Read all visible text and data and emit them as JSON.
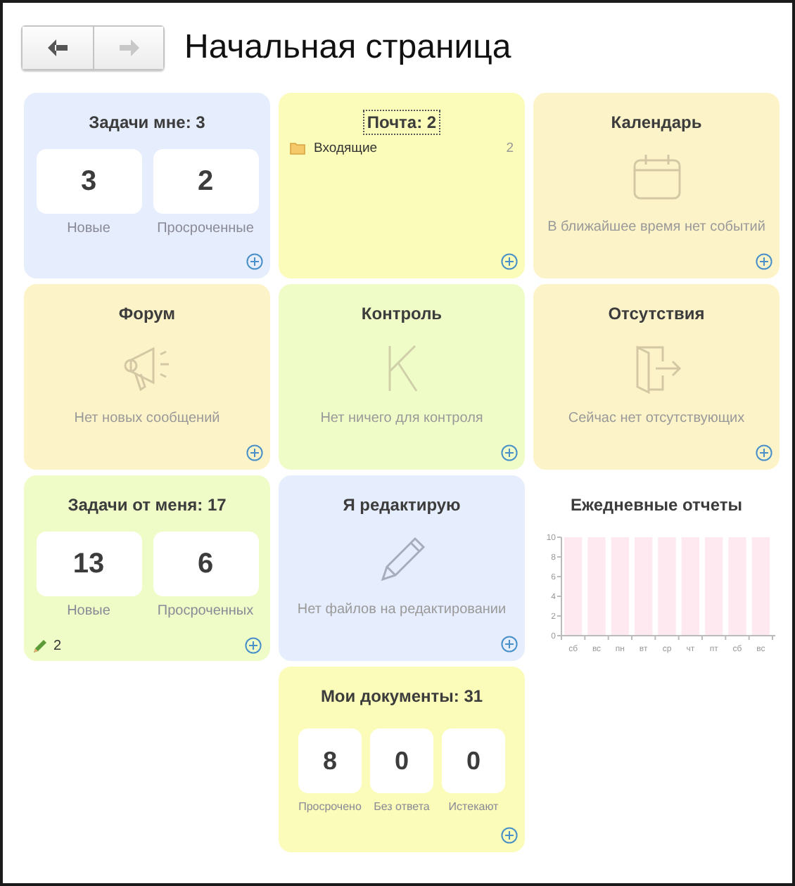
{
  "nav": {
    "back": {
      "disabled": false
    },
    "forward": {
      "disabled": true
    }
  },
  "title": "Начальная страница",
  "tiles": [
    {
      "kind": "counters",
      "title": "Задачи мне: 3",
      "color": "#e6edfc",
      "focused": false,
      "counters": [
        {
          "value": "3",
          "label": "Новые"
        },
        {
          "value": "2",
          "label": "Просроченные"
        }
      ]
    },
    {
      "kind": "mail",
      "title": "Почта: 2",
      "color": "#fbfcb9",
      "focused": true,
      "folders": [
        {
          "name": "Входящие",
          "count": "2"
        }
      ]
    },
    {
      "kind": "empty",
      "title": "Календарь",
      "color": "#fdf3c9",
      "focused": false,
      "message": "В ближайшее время нет событий"
    },
    {
      "kind": "empty",
      "title": "Форум",
      "color": "#fdf3c9",
      "focused": false,
      "message": "Нет новых сообщений"
    },
    {
      "kind": "empty",
      "title": "Контроль",
      "color": "#f0fcc8",
      "focused": false,
      "message": "Нет ничего для контроля"
    },
    {
      "kind": "empty",
      "title": "Отсутствия",
      "color": "#fdf3c9",
      "focused": false,
      "message": "Сейчас нет отсутствующих"
    },
    {
      "kind": "counters",
      "title": "Задачи от меня: 17",
      "color": "#f0fcc8",
      "focused": false,
      "counters": [
        {
          "value": "13",
          "label": "Новые"
        },
        {
          "value": "6",
          "label": "Просроченных"
        }
      ],
      "edits": "2"
    },
    {
      "kind": "empty",
      "title": "Я редактирую",
      "color": "#e6edfc",
      "focused": false,
      "message": "Нет файлов на редактировании"
    },
    {
      "kind": "chart",
      "title": "Ежедневные отчеты",
      "focused": false,
      "chart_data": {
        "type": "bar",
        "categories": [
          "сб",
          "вс",
          "пн",
          "вт",
          "ср",
          "чт",
          "пт",
          "сб",
          "вс"
        ],
        "series": [
          {
            "color": "#fde9ef",
            "values": [
              10,
              10,
              10,
              10,
              10,
              10,
              10,
              10,
              10
            ]
          }
        ],
        "ylim": [
          0,
          10
        ],
        "yticks": [
          0,
          2,
          4,
          6,
          8,
          10
        ]
      }
    },
    {
      "kind": "counters",
      "title": "Мои документы: 31",
      "color": "#fbfcb9",
      "focused": false,
      "counters": [
        {
          "value": "8",
          "label": "Просрочено"
        },
        {
          "value": "0",
          "label": "Без ответа"
        },
        {
          "value": "0",
          "label": "Истекают"
        }
      ]
    }
  ]
}
